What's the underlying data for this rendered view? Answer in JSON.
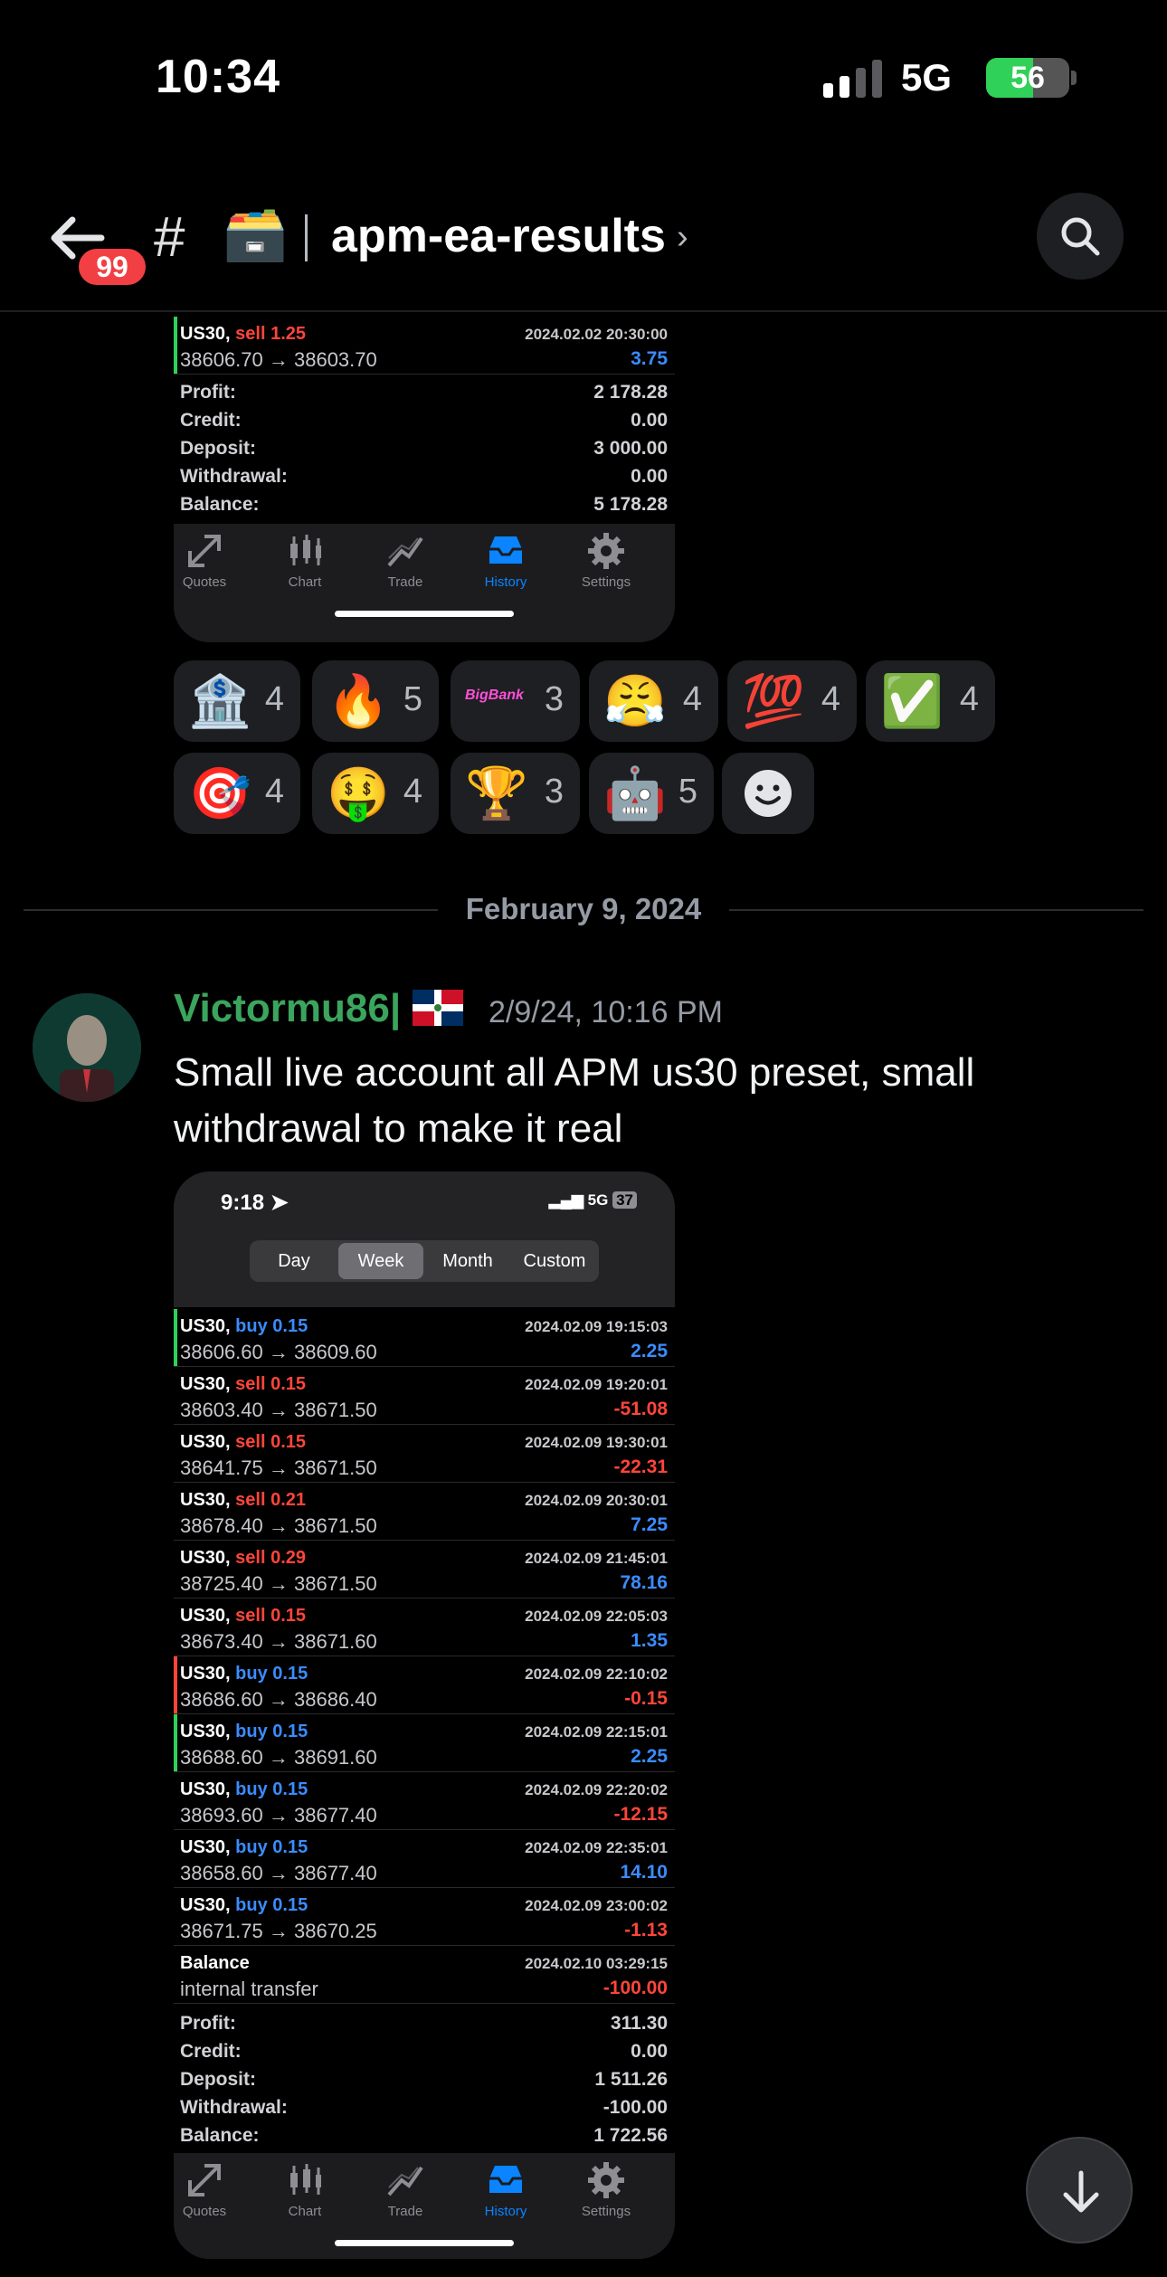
{
  "status_bar": {
    "time": "10:34",
    "network": "5G",
    "battery": "56",
    "battery_level": 56
  },
  "header": {
    "mention_count": "99",
    "channel_name": "apm-ea-results",
    "box_emoji": "🗃️"
  },
  "shot1": {
    "trades": [
      {
        "symbol": "US30,",
        "action": "sell 1.25",
        "side": "sell",
        "time": "2024.02.02 20:30:00",
        "price": "38606.70 → 38603.70",
        "pl": "3.75",
        "pl_sign": "pos",
        "accent": "#30d158"
      }
    ],
    "summary": [
      {
        "label": "Profit:",
        "value": "2 178.28"
      },
      {
        "label": "Credit:",
        "value": "0.00"
      },
      {
        "label": "Deposit:",
        "value": "3 000.00"
      },
      {
        "label": "Withdrawal:",
        "value": "0.00"
      },
      {
        "label": "Balance:",
        "value": "5 178.28"
      }
    ]
  },
  "tabs": [
    {
      "label": "Quotes",
      "icon": "quotes-icon"
    },
    {
      "label": "Chart",
      "icon": "chart-icon"
    },
    {
      "label": "Trade",
      "icon": "trade-icon"
    },
    {
      "label": "History",
      "icon": "history-icon",
      "active": true
    },
    {
      "label": "Settings",
      "icon": "settings-icon"
    }
  ],
  "reactions": [
    {
      "emoji": "🏦",
      "count": "4"
    },
    {
      "emoji": "🔥",
      "count": "5"
    },
    {
      "emoji": "BigBank",
      "count": "3"
    },
    {
      "emoji": "😤",
      "count": "4"
    },
    {
      "emoji": "💯",
      "count": "4"
    },
    {
      "emoji": "✅",
      "count": "4"
    },
    {
      "emoji": "🎯",
      "count": "4"
    },
    {
      "emoji": "🤑",
      "count": "4"
    },
    {
      "emoji": "🏆",
      "count": "3"
    },
    {
      "emoji": "🤖",
      "count": "5"
    }
  ],
  "date_divider": "February 9, 2024",
  "message": {
    "author": "Victormu86|",
    "timestamp": "2/9/24, 10:16 PM",
    "text": "Small live account all APM us30 preset, small withdrawal to make it real"
  },
  "shot2": {
    "phone_time": "9:18",
    "phone_network": "5G",
    "phone_battery": "37",
    "segments": [
      "Day",
      "Week",
      "Month",
      "Custom"
    ],
    "selected_segment": "Week",
    "trades": [
      {
        "symbol": "US30,",
        "action": "buy 0.15",
        "side": "buy",
        "time": "2024.02.09 19:15:03",
        "price": "38606.60 → 38609.60",
        "pl": "2.25",
        "pl_sign": "pos",
        "accent": "#30d158"
      },
      {
        "symbol": "US30,",
        "action": "sell 0.15",
        "side": "sell",
        "time": "2024.02.09 19:20:01",
        "price": "38603.40 → 38671.50",
        "pl": "-51.08",
        "pl_sign": "neg",
        "accent": ""
      },
      {
        "symbol": "US30,",
        "action": "sell 0.15",
        "side": "sell",
        "time": "2024.02.09 19:30:01",
        "price": "38641.75 → 38671.50",
        "pl": "-22.31",
        "pl_sign": "neg",
        "accent": ""
      },
      {
        "symbol": "US30,",
        "action": "sell 0.21",
        "side": "sell",
        "time": "2024.02.09 20:30:01",
        "price": "38678.40 → 38671.50",
        "pl": "7.25",
        "pl_sign": "pos",
        "accent": ""
      },
      {
        "symbol": "US30,",
        "action": "sell 0.29",
        "side": "sell",
        "time": "2024.02.09 21:45:01",
        "price": "38725.40 → 38671.50",
        "pl": "78.16",
        "pl_sign": "pos",
        "accent": ""
      },
      {
        "symbol": "US30,",
        "action": "sell 0.15",
        "side": "sell",
        "time": "2024.02.09 22:05:03",
        "price": "38673.40 → 38671.60",
        "pl": "1.35",
        "pl_sign": "pos",
        "accent": ""
      },
      {
        "symbol": "US30,",
        "action": "buy 0.15",
        "side": "buy",
        "time": "2024.02.09 22:10:02",
        "price": "38686.60 → 38686.40",
        "pl": "-0.15",
        "pl_sign": "neg",
        "accent": "#ff453a"
      },
      {
        "symbol": "US30,",
        "action": "buy 0.15",
        "side": "buy",
        "time": "2024.02.09 22:15:01",
        "price": "38688.60 → 38691.60",
        "pl": "2.25",
        "pl_sign": "pos",
        "accent": "#30d158"
      },
      {
        "symbol": "US30,",
        "action": "buy 0.15",
        "side": "buy",
        "time": "2024.02.09 22:20:02",
        "price": "38693.60 → 38677.40",
        "pl": "-12.15",
        "pl_sign": "neg",
        "accent": ""
      },
      {
        "symbol": "US30,",
        "action": "buy 0.15",
        "side": "buy",
        "time": "2024.02.09 22:35:01",
        "price": "38658.60 → 38677.40",
        "pl": "14.10",
        "pl_sign": "pos",
        "accent": ""
      },
      {
        "symbol": "US30,",
        "action": "buy 0.15",
        "side": "buy",
        "time": "2024.02.09 23:00:02",
        "price": "38671.75 → 38670.25",
        "pl": "-1.13",
        "pl_sign": "neg",
        "accent": ""
      },
      {
        "symbol": "Balance",
        "action": "",
        "side": "",
        "time": "2024.02.10 03:29:15",
        "price": "internal transfer",
        "pl": "-100.00",
        "pl_sign": "neg",
        "accent": ""
      }
    ],
    "summary": [
      {
        "label": "Profit:",
        "value": "311.30"
      },
      {
        "label": "Credit:",
        "value": "0.00"
      },
      {
        "label": "Deposit:",
        "value": "1 511.26"
      },
      {
        "label": "Withdrawal:",
        "value": "-100.00"
      },
      {
        "label": "Balance:",
        "value": "1 722.56"
      }
    ]
  }
}
